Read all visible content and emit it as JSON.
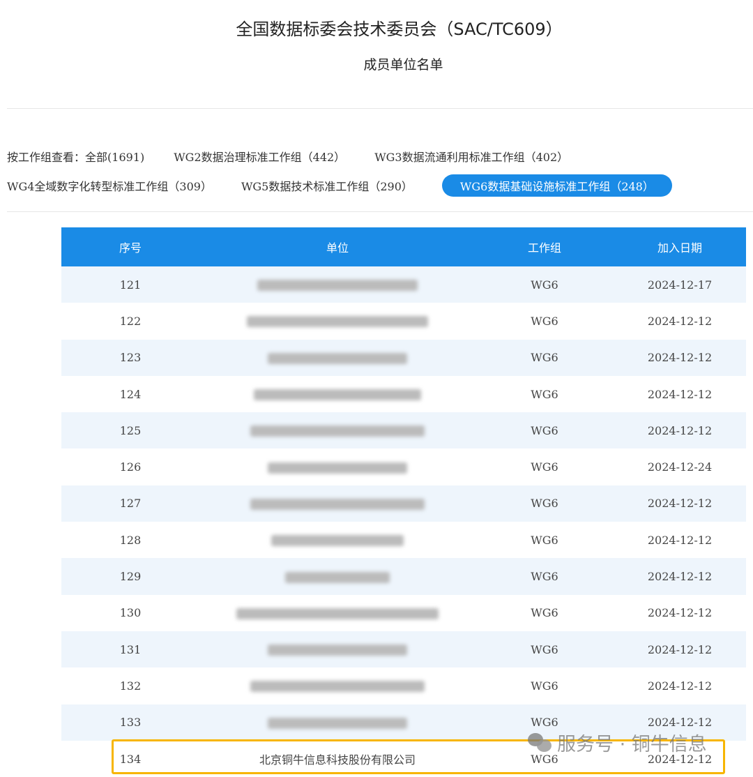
{
  "header": {
    "title": "全国数据标委会技术委员会（SAC/TC609）",
    "subtitle": "成员单位名单"
  },
  "filters": {
    "label": "按工作组查看：",
    "items": [
      {
        "label": "全部(1691)"
      },
      {
        "label": "WG2数据治理标准工作组（442）"
      },
      {
        "label": "WG3数据流通利用标准工作组（402）"
      },
      {
        "label": "WG4全域数字化转型标准工作组（309）"
      },
      {
        "label": "WG5数据技术标准工作组（290）"
      },
      {
        "label": "WG6数据基础设施标准工作组（248）",
        "active": true
      }
    ]
  },
  "table": {
    "headers": [
      "序号",
      "单位",
      "工作组",
      "加入日期"
    ],
    "rows": [
      {
        "no": "121",
        "unit": "",
        "group": "WG6",
        "date": "2024-12-17"
      },
      {
        "no": "122",
        "unit": "",
        "group": "WG6",
        "date": "2024-12-12"
      },
      {
        "no": "123",
        "unit": "",
        "group": "WG6",
        "date": "2024-12-12"
      },
      {
        "no": "124",
        "unit": "",
        "group": "WG6",
        "date": "2024-12-12"
      },
      {
        "no": "125",
        "unit": "",
        "group": "WG6",
        "date": "2024-12-12"
      },
      {
        "no": "126",
        "unit": "",
        "group": "WG6",
        "date": "2024-12-24"
      },
      {
        "no": "127",
        "unit": "",
        "group": "WG6",
        "date": "2024-12-12"
      },
      {
        "no": "128",
        "unit": "",
        "group": "WG6",
        "date": "2024-12-12"
      },
      {
        "no": "129",
        "unit": "",
        "group": "WG6",
        "date": "2024-12-12"
      },
      {
        "no": "130",
        "unit": "",
        "group": "WG6",
        "date": "2024-12-12"
      },
      {
        "no": "131",
        "unit": "",
        "group": "WG6",
        "date": "2024-12-12"
      },
      {
        "no": "132",
        "unit": "",
        "group": "WG6",
        "date": "2024-12-12"
      },
      {
        "no": "133",
        "unit": "",
        "group": "WG6",
        "date": "2024-12-12"
      },
      {
        "no": "134",
        "unit": "北京铜牛信息科技股份有限公司",
        "group": "WG6",
        "date": "2024-12-12"
      }
    ]
  },
  "watermark": {
    "text": "服务号 · 铜牛信息"
  },
  "colors": {
    "accent": "#1a8be6",
    "highlight": "#f7b500",
    "row_alt": "#eef5fc"
  }
}
